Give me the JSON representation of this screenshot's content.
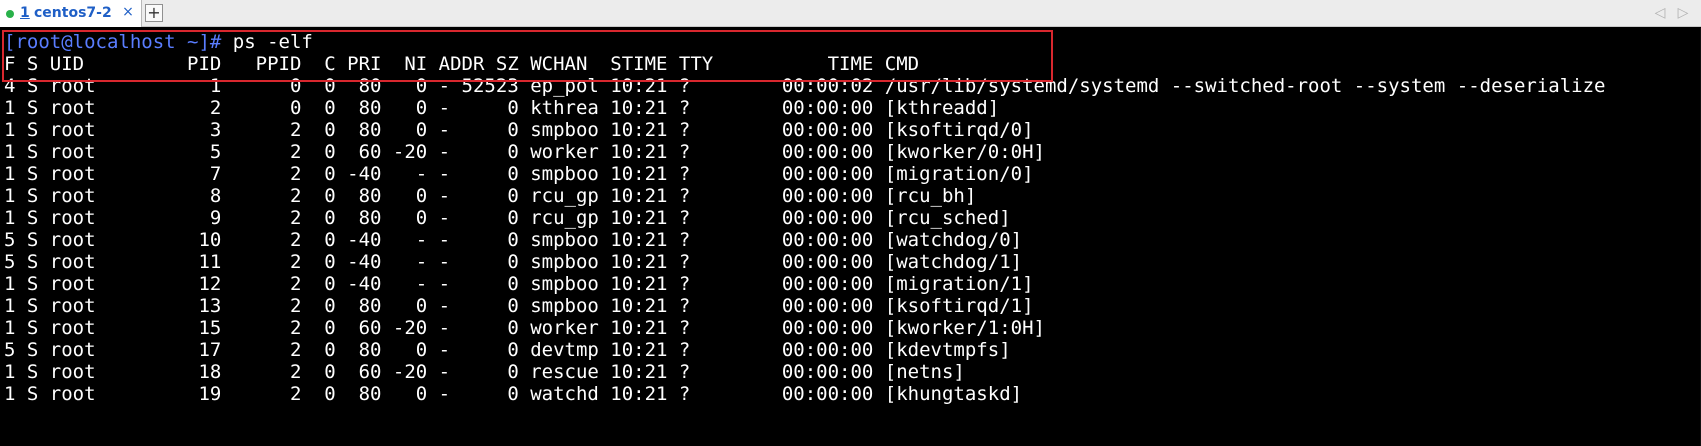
{
  "tabbar": {
    "tab": {
      "number": "1",
      "label": "centos7-2",
      "close": "×"
    },
    "new_tab": "+",
    "scroll_left": "◁",
    "scroll_right": "▷"
  },
  "terminal": {
    "prompt": "[root@localhost ~]#",
    "command": " ps -elf",
    "header": "F S UID         PID   PPID  C PRI  NI ADDR SZ WCHAN  STIME TTY          TIME CMD",
    "rows": [
      "4 S root          1      0  0  80   0 - 52523 ep_pol 10:21 ?        00:00:02 /usr/lib/systemd/systemd --switched-root --system --deserialize",
      "1 S root          2      0  0  80   0 -     0 kthrea 10:21 ?        00:00:00 [kthreadd]",
      "1 S root          3      2  0  80   0 -     0 smpboo 10:21 ?        00:00:00 [ksoftirqd/0]",
      "1 S root          5      2  0  60 -20 -     0 worker 10:21 ?        00:00:00 [kworker/0:0H]",
      "1 S root          7      2  0 -40   - -     0 smpboo 10:21 ?        00:00:00 [migration/0]",
      "1 S root          8      2  0  80   0 -     0 rcu_gp 10:21 ?        00:00:00 [rcu_bh]",
      "1 S root          9      2  0  80   0 -     0 rcu_gp 10:21 ?        00:00:00 [rcu_sched]",
      "5 S root         10      2  0 -40   - -     0 smpboo 10:21 ?        00:00:00 [watchdog/0]",
      "5 S root         11      2  0 -40   - -     0 smpboo 10:21 ?        00:00:00 [watchdog/1]",
      "1 S root         12      2  0 -40   - -     0 smpboo 10:21 ?        00:00:00 [migration/1]",
      "1 S root         13      2  0  80   0 -     0 smpboo 10:21 ?        00:00:00 [ksoftirqd/1]",
      "1 S root         15      2  0  60 -20 -     0 worker 10:21 ?        00:00:00 [kworker/1:0H]",
      "5 S root         17      2  0  80   0 -     0 devtmp 10:21 ?        00:00:00 [kdevtmpfs]",
      "1 S root         18      2  0  60 -20 -     0 rescue 10:21 ?        00:00:00 [netns]",
      "1 S root         19      2  0  80   0 -     0 watchd 10:21 ?        00:00:00 [khungtaskd]"
    ]
  },
  "colors": {
    "background": "#000000",
    "text": "#ffffff",
    "prompt": "#5a7dff",
    "highlight_border": "#d9272e",
    "tab_text": "#1f5fc6",
    "tab_status": "#29b14a"
  }
}
